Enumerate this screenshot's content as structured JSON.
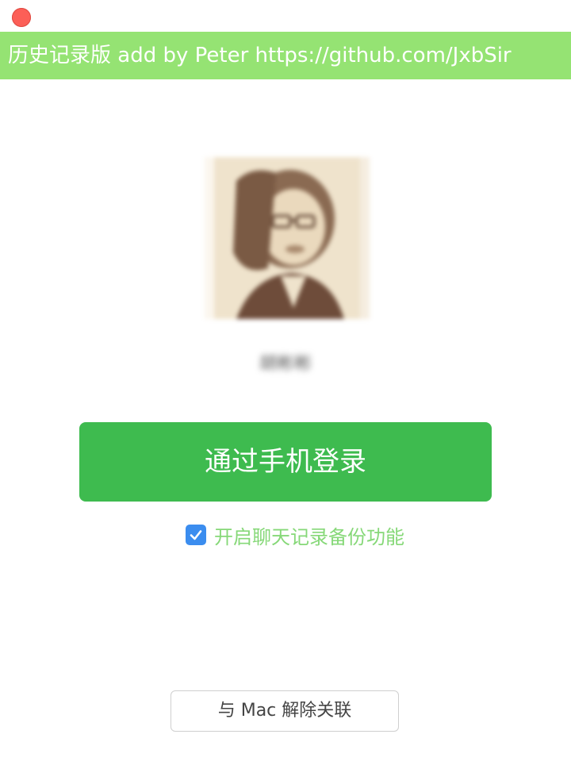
{
  "window": {
    "close_color": "#fc5f57"
  },
  "banner": {
    "text": "历史记录版 add by Peter https://github.com/JxbSir",
    "bg_color": "#95e373"
  },
  "profile": {
    "avatar_icon": "user-avatar-photo",
    "username": "胡彬彬"
  },
  "login": {
    "button_label": "通过手机登录",
    "color": "#3ebb4f"
  },
  "backup": {
    "checked": true,
    "label": "开启聊天记录备份功能",
    "check_icon": "checkmark-icon"
  },
  "unlink": {
    "button_label": "与 Mac 解除关联"
  }
}
